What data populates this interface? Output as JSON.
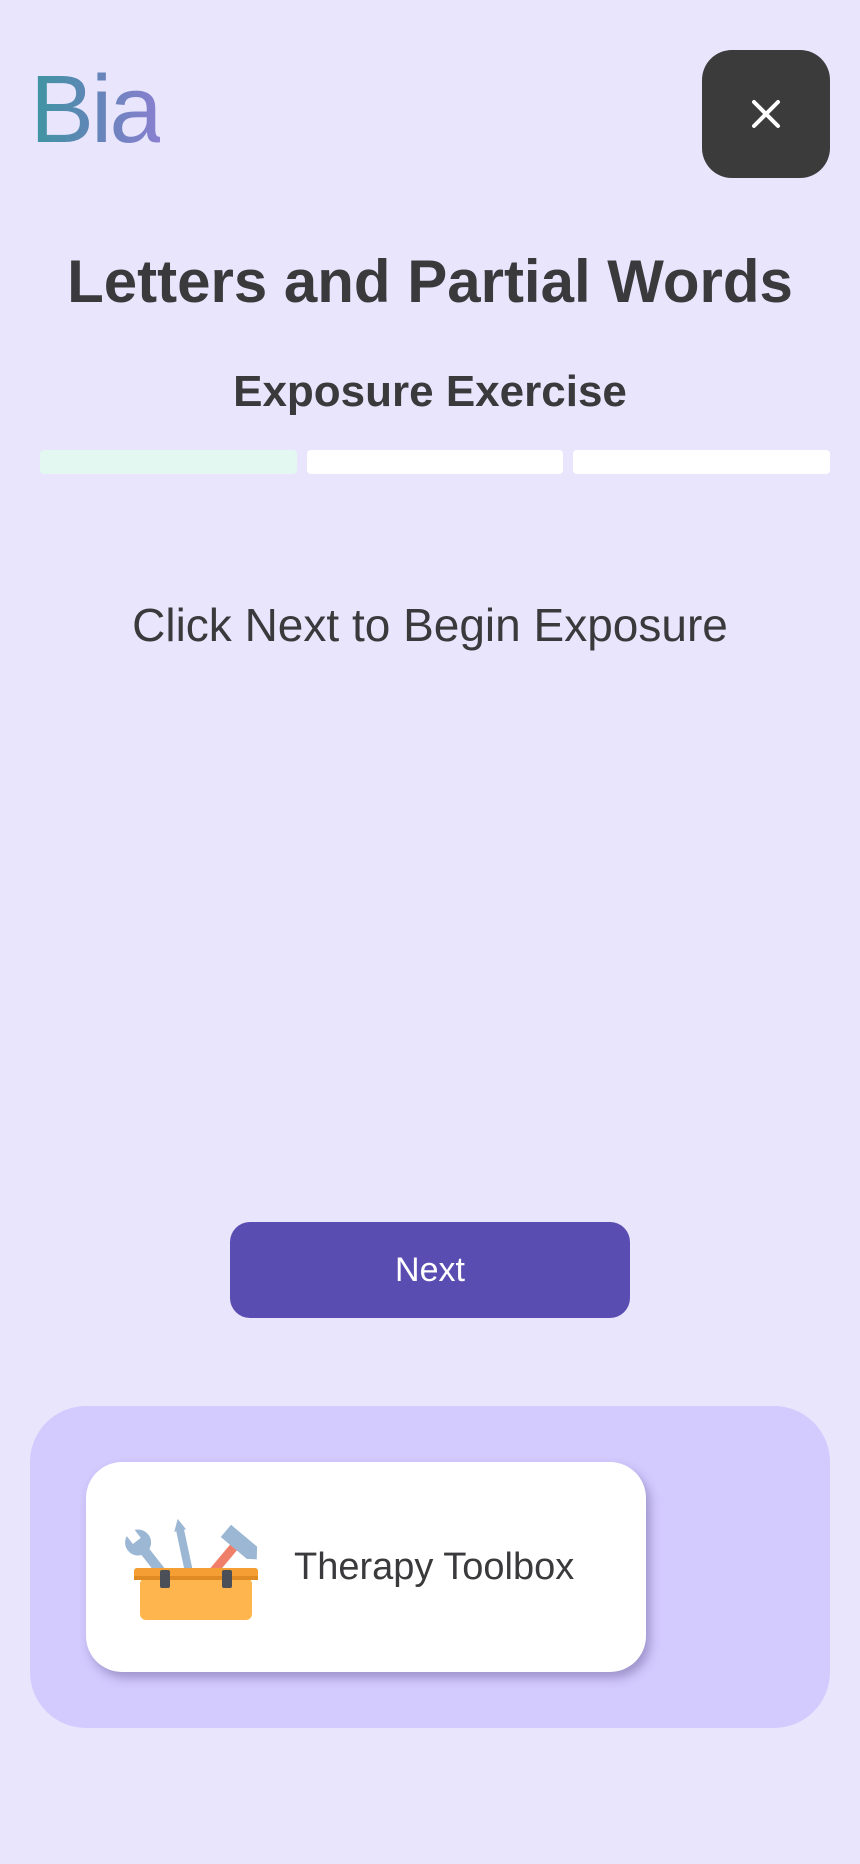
{
  "app": {
    "logo_text": "Bia"
  },
  "header": {
    "close_icon": "close-icon"
  },
  "exercise": {
    "title": "Letters and Partial Words",
    "subtitle": "Exposure Exercise",
    "progress": {
      "total_steps": 3,
      "completed_steps": 1
    },
    "prompt": "Click Next to Begin Exposure"
  },
  "actions": {
    "next_label": "Next"
  },
  "toolbox": {
    "label": "Therapy Toolbox",
    "icon": "toolbox-icon"
  },
  "colors": {
    "background": "#e8e5fd",
    "accent": "#5a4db1",
    "panel": "#d3cafe",
    "progress_done": "#e2f8f0",
    "progress_todo": "#ffffff",
    "close_button": "#3b3b3b"
  }
}
